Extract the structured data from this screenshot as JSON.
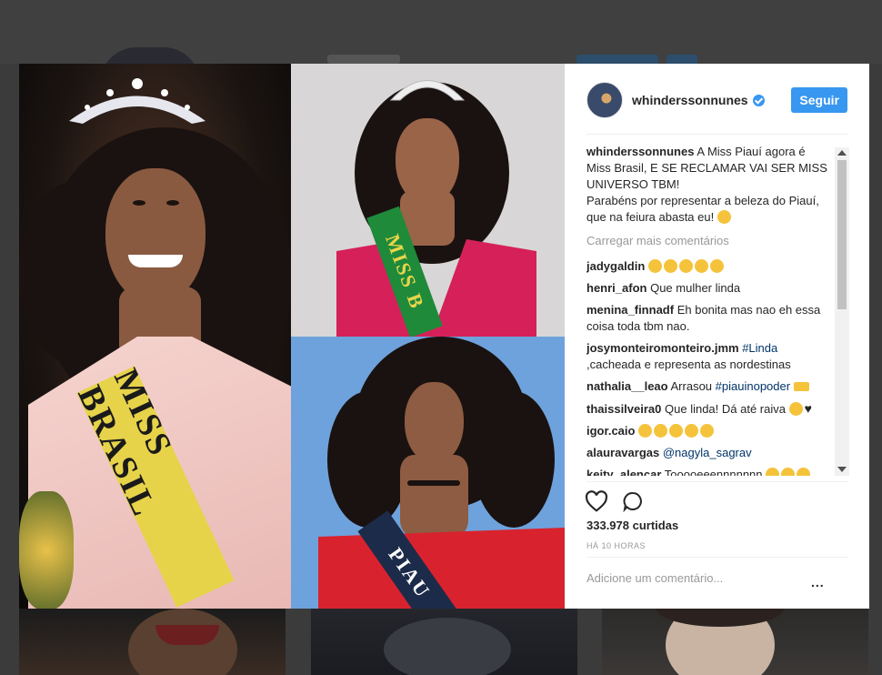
{
  "post": {
    "username": "whinderssonnunes",
    "follow_label": "Seguir",
    "caption_user": "whinderssonnunes",
    "caption_text": "A Miss Piauí agora é Miss Brasil, E SE RECLAMAR VAI SER MISS UNIVERSO TBM!",
    "caption_text_2": "Parabéns por representar a beleza do Piauí, que na feiura abasta eu!",
    "load_more": "Carregar mais comentários",
    "likes": "333.978 curtidas",
    "time": "HÁ 10 HORAS",
    "add_comment_placeholder": "Adicione um comentário...",
    "more_label": "..."
  },
  "photo": {
    "sash_left": "MISS BRASIL",
    "sash_top_right": "MISS B",
    "sash_bottom_right": "PIAU"
  },
  "comments": [
    {
      "user": "jadygaldin",
      "text": "",
      "tag": "",
      "emoji": [
        "laugh",
        "laugh",
        "laugh",
        "laugh",
        "laugh"
      ]
    },
    {
      "user": "henri_afon",
      "text": "Que mulher linda",
      "tag": "",
      "emoji": []
    },
    {
      "user": "menina_finnadf",
      "text": "Eh bonita mas nao eh essa coisa toda tbm nao.",
      "tag": "",
      "emoji": []
    },
    {
      "user": "josymonteiromonteiro.jmm",
      "text": ",cacheada e representa as nordestinas",
      "tag": "#Linda",
      "emoji": []
    },
    {
      "user": "nathalia__leao",
      "text": "Arrasou",
      "tag": "#piauinopoder",
      "emoji": [
        "crown"
      ]
    },
    {
      "user": "thaissilveira0",
      "text": "Que linda! Dá até raiva",
      "tag": "",
      "emoji": [
        "laugh",
        "heart"
      ]
    },
    {
      "user": "igor.caio",
      "text": "",
      "tag": "",
      "emoji": [
        "clap",
        "clap",
        "clap",
        "clap",
        "love"
      ]
    },
    {
      "user": "alauravargas",
      "text": "",
      "tag": "@nagyla_sagrav",
      "emoji": []
    },
    {
      "user": "keity_alencar",
      "text": "Tooooeeennnnnnn",
      "tag": "",
      "emoji": [
        "clap",
        "clap",
        "clap"
      ]
    }
  ],
  "colors": {
    "accent": "#3897f0",
    "link": "#003569",
    "overlay": "#3b3b3b"
  },
  "icons": {
    "like": "heart-outline-icon",
    "comment": "speech-bubble-icon",
    "verified": "verified-badge-icon"
  }
}
